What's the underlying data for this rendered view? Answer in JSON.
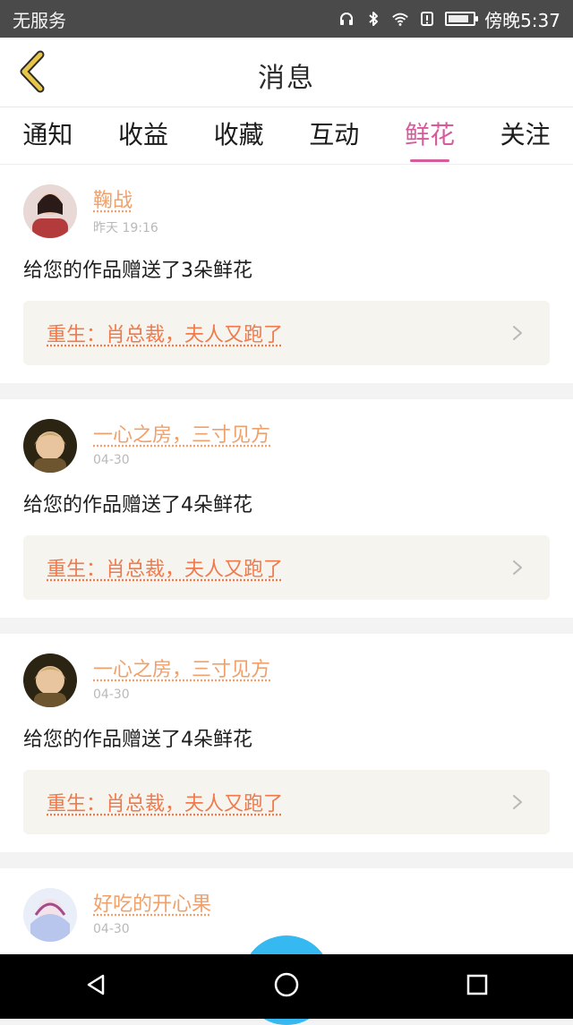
{
  "status_bar": {
    "carrier": "无服务",
    "time": "傍晚5:37",
    "icons": [
      "headphones-icon",
      "bluetooth-icon",
      "wifi-icon",
      "alert-icon",
      "battery-icon"
    ]
  },
  "app_bar": {
    "title": "消息",
    "back_icon": "back-chevron-icon",
    "accent_color": "#e7c64a"
  },
  "tabs": [
    {
      "label": "通知",
      "active": false
    },
    {
      "label": "收益",
      "active": false
    },
    {
      "label": "收藏",
      "active": false
    },
    {
      "label": "互动",
      "active": false
    },
    {
      "label": "鲜花",
      "active": true
    },
    {
      "label": "关注",
      "active": false
    }
  ],
  "notifications": [
    {
      "username": "鞠战",
      "time": "昨天 19:16",
      "message": "给您的作品赠送了3朵鲜花",
      "work_title": "重生：肖总裁，夫人又跑了",
      "avatar_icon": "user-avatar-1"
    },
    {
      "username": "一心之房，三寸见方",
      "time": "04-30",
      "message": "给您的作品赠送了4朵鲜花",
      "work_title": "重生：肖总裁，夫人又跑了",
      "avatar_icon": "user-avatar-2"
    },
    {
      "username": "一心之房，三寸见方",
      "time": "04-30",
      "message": "给您的作品赠送了4朵鲜花",
      "work_title": "重生：肖总裁，夫人又跑了",
      "avatar_icon": "user-avatar-3"
    },
    {
      "username": "好吃的开心果",
      "time": "04-30",
      "message": "",
      "work_title": "",
      "avatar_icon": "user-avatar-4"
    }
  ],
  "colors": {
    "active_tab": "#d75a9a",
    "username": "#f0a06a",
    "work_title": "#f07a4b",
    "fab": "#36b9f0"
  },
  "nav_bar": {
    "icons": [
      "back-triangle-icon",
      "home-circle-icon",
      "recents-square-icon"
    ]
  }
}
